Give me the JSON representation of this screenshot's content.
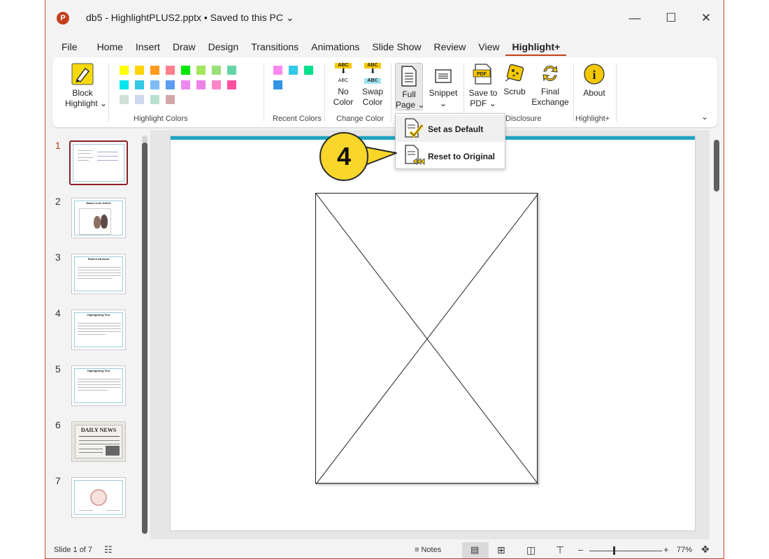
{
  "window": {
    "app_icon": "P",
    "title": "db5 - HighlightPLUS2.pptx • Saved to this PC ⌄",
    "buttons": {
      "minimize": "—",
      "maximize": "☐",
      "close": "✕"
    }
  },
  "tabs": [
    "File",
    "Home",
    "Insert",
    "Draw",
    "Design",
    "Transitions",
    "Animations",
    "Slide Show",
    "Review",
    "View",
    "Highlight+"
  ],
  "active_tab": "Highlight+",
  "ribbon": {
    "block_highlight": {
      "line1": "Block",
      "line2": "Highlight ⌄",
      "icon": "highlighter-icon"
    },
    "highlight_colors_label": "Highlight Colors",
    "highlight_colors": [
      "#ffff00",
      "#ffd400",
      "#ff9a1f",
      "#ff7f8c",
      "#00e600",
      "#a3e65c",
      "#99e07a",
      "#66d4a6",
      "#00e5f0",
      "#33c8e6",
      "#7dbcf5",
      "#5d9cf5",
      "#ee88f0",
      "#ee82e6",
      "#ff85c8",
      "#ff4f9f",
      "#cfe0d7",
      "#cdd8ee",
      "#b8e0d0",
      "#d3a8a8"
    ],
    "recent_colors_label": "Recent Colors",
    "recent_colors": [
      "#ff88f0",
      "#33c8e6",
      "#00e08a",
      "#3393e6"
    ],
    "no_color": {
      "badge_top": "ABC",
      "badge_bottom": "ABC",
      "line1": "No",
      "line2": "Color"
    },
    "swap_color": {
      "badge_top": "ABC",
      "badge_bottom": "ABC",
      "line1": "Swap",
      "line2": "Color"
    },
    "change_color_label": "Change Color",
    "full_page": {
      "line1": "Full",
      "line2": "Page ⌄"
    },
    "snippet": {
      "line1": "Snippet",
      "line2": "⌄"
    },
    "save_to_pdf": {
      "badge": "PDF",
      "line1": "Save to",
      "line2": "PDF ⌄"
    },
    "scrub": {
      "label": "Scrub"
    },
    "final_exchange": {
      "line1": "Final",
      "line2": "Exchange"
    },
    "disclosure_label": "Disclosure",
    "about": {
      "label": "About",
      "icon_text": "i"
    },
    "highlight_plus_label": "Highlight+",
    "collapse": "⌄"
  },
  "menu": {
    "set_default": "Set as Default",
    "reset_original": "Reset to Original"
  },
  "callout_number": "4",
  "slides": {
    "numbers": [
      "1",
      "2",
      "3",
      "4",
      "5",
      "6",
      "7"
    ],
    "thumb_titles": [
      "",
      "Nature.com Article",
      "Patient Abstract",
      "Highlighting Text",
      "Highlighting Text",
      "DAILY NEWS",
      ""
    ]
  },
  "status": {
    "slide_counter": "Slide 1 of 7",
    "notes": "Notes",
    "zoom": "77%"
  }
}
